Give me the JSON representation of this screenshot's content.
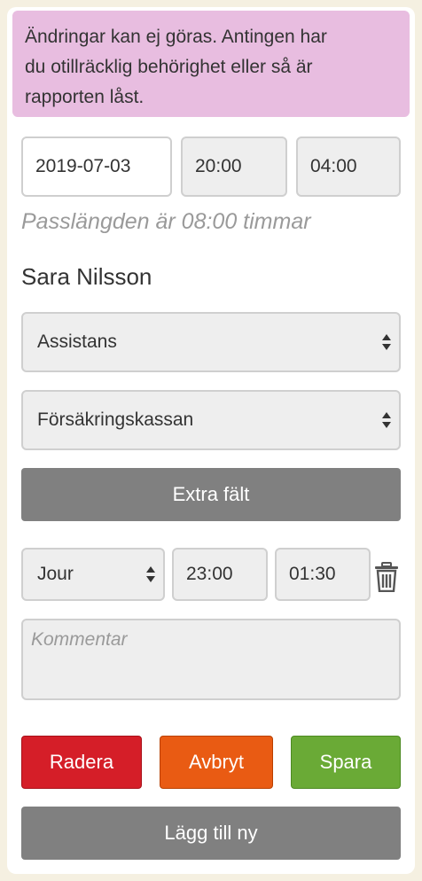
{
  "notice": {
    "line1": "Ändringar kan ej göras. Antingen har",
    "line2": "du otillräcklig behörighet eller så är",
    "line3": "rapporten låst."
  },
  "shift": {
    "date": "2019-07-03",
    "start_time": "20:00",
    "end_time": "04:00",
    "duration_text": "Passlängden är 08:00 timmar"
  },
  "person": {
    "name": "Sara Nilsson"
  },
  "selects": {
    "type": "Assistans",
    "payer": "Försäkringskassan"
  },
  "extra_fields_label": "Extra fält",
  "row": {
    "kind": "Jour",
    "start": "23:00",
    "end": "01:30",
    "delete_icon": "trash-icon"
  },
  "comment": {
    "placeholder": "Kommentar"
  },
  "actions": {
    "delete": "Radera",
    "cancel": "Avbryt",
    "save": "Spara",
    "add_new": "Lägg till ny"
  },
  "colors": {
    "notice_bg": "#e8bde0",
    "delete": "#d51e28",
    "cancel": "#e95b13",
    "save": "#6aaa36",
    "neutral": "#808080"
  }
}
